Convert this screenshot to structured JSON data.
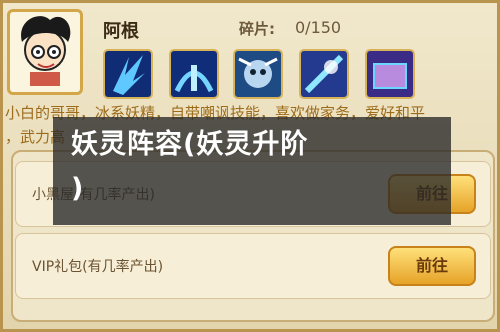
{
  "hero": {
    "name": "阿根",
    "fragments_label": "碎片:",
    "fragments_value": "0/150"
  },
  "skills": [
    {
      "icon": "ice-blades-icon"
    },
    {
      "icon": "ice-wave-icon"
    },
    {
      "icon": "storm-face-icon"
    },
    {
      "icon": "lightning-slash-icon"
    },
    {
      "icon": "ice-gate-icon"
    }
  ],
  "description": {
    "line1": "小白的哥哥，冰系妖精，自带嘲讽技能，喜欢做家务，爱好和平",
    "line2": "，武力高"
  },
  "overlay": {
    "title": "妖灵阵容(妖灵升阶\n)"
  },
  "sources": [
    {
      "label": "小黑屋(有几率产出)",
      "button": "前往"
    },
    {
      "label": "VIP礼包(有几率产出)",
      "button": "前往"
    }
  ]
}
